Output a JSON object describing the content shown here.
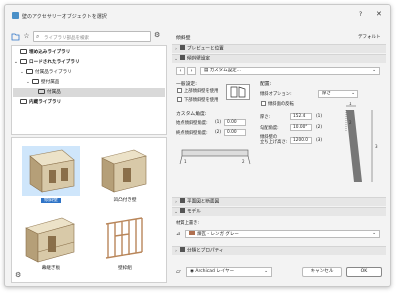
{
  "window": {
    "title": "壁のアクセサリーオブジェクトを選択",
    "help_label": "?",
    "close_label": "✕"
  },
  "left": {
    "search_placeholder": "ライブラリ部品を検索",
    "tree": [
      {
        "label": "埋め込みライブラリ",
        "bold": true,
        "twisty": "",
        "indent": 0
      },
      {
        "label": "ロードされたライブラリ",
        "bold": true,
        "twisty": "⌄",
        "indent": 0
      },
      {
        "label": "付属品ライブラリ",
        "bold": false,
        "twisty": "⌄",
        "indent": 1
      },
      {
        "label": "壁付属品",
        "bold": false,
        "twisty": "⌄",
        "indent": 2
      },
      {
        "label": "付属品",
        "bold": false,
        "twisty": "",
        "indent": 3,
        "selected": true
      },
      {
        "label": "内蔵ライブラリ",
        "bold": true,
        "twisty": "",
        "indent": 0
      }
    ],
    "thumbnails": [
      {
        "label": "傾斜壁",
        "selected": true
      },
      {
        "label": "凹凸付き壁",
        "selected": false
      },
      {
        "label": "幕継ぎ板",
        "selected": false
      },
      {
        "label": "壁枠組",
        "selected": false
      }
    ]
  },
  "right": {
    "object_name": "傾斜壁",
    "default_label": "デフォルト",
    "sections": {
      "preview": "プレビューと位置",
      "settings": "傾斜壁設定",
      "floorplan": "平面図と断面図",
      "model": "モデル",
      "classification": "分類とプロパティ"
    },
    "custom_settings": "カスタム設定...",
    "general": {
      "header": "一般設定:",
      "top_slope": "上部傾斜壁を使用",
      "bottom_slope": "下部傾斜壁を使用"
    },
    "placement": {
      "header": "配置:",
      "slope_option_label": "傾斜オプション:",
      "slope_option_value": "厚さ",
      "inverse_label": "傾斜面の反転",
      "thickness_label": "厚さ:",
      "thickness_value": "152.4",
      "thickness_idx": "(1)",
      "slope_angle_label": "勾配角度:",
      "slope_angle_value": "10.00°",
      "slope_angle_idx": "(2)",
      "height_label": "傾斜壁の\n立ち上げ高さ:",
      "height_value": "1200.0",
      "height_idx": "(3)"
    },
    "custom_angle": {
      "header": "カスタム角度:",
      "start_label": "始点傾斜壁角度:",
      "start_idx": "(1)",
      "start_value": "0.00",
      "end_label": "終点傾斜壁角度:",
      "end_idx": "(2)",
      "end_value": "0.00"
    },
    "model": {
      "material_label": "材質上書き:",
      "material_value": "煉瓦 - レンガ グレー"
    },
    "footer": {
      "layer_value": "Archicad レイヤー",
      "cancel": "キャンセル",
      "ok": "OK"
    }
  },
  "colors": {
    "accent": "#2f74c7",
    "selection_tile": "#cfe6fb",
    "wall": "#d8c9a8",
    "wall_dark": "#8a6f4a"
  }
}
